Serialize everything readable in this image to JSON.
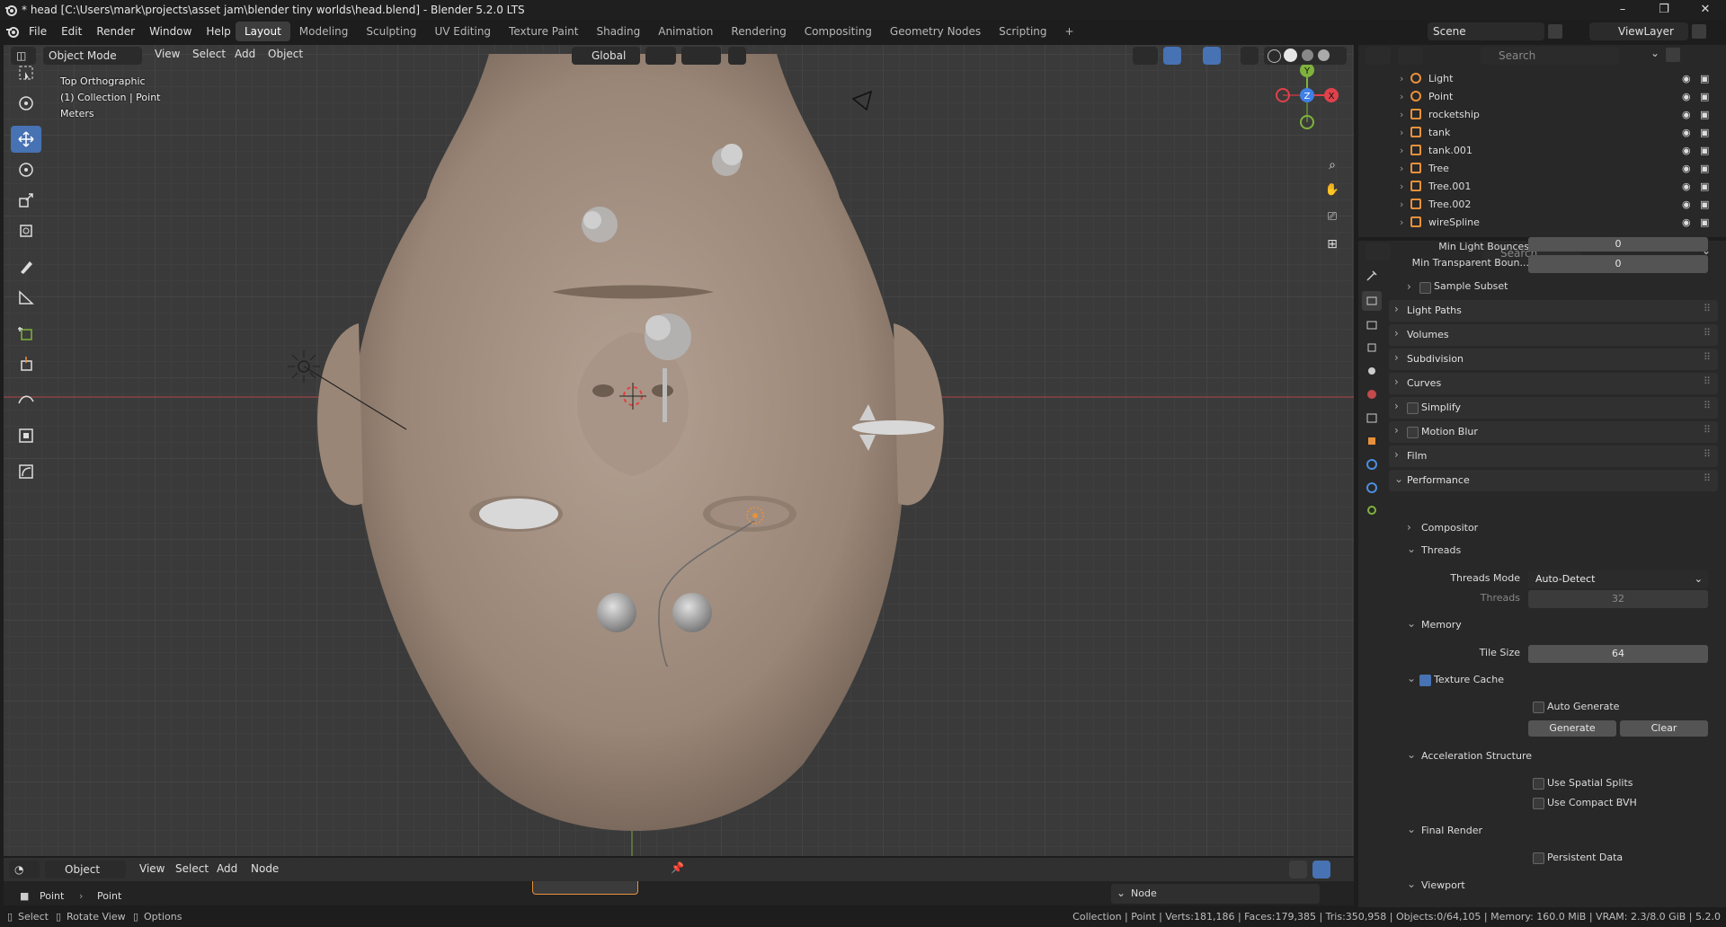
{
  "title_bar": {
    "title": "* head [C:\\Users\\mark\\projects\\asset jam\\blender tiny worlds\\head.blend] - Blender 5.2.0 LTS",
    "minimize": "–",
    "maximize": "❐",
    "close": "✕"
  },
  "menu": [
    "File",
    "Edit",
    "Render",
    "Window",
    "Help"
  ],
  "workspaces": [
    "Layout",
    "Modeling",
    "Sculpting",
    "UV Editing",
    "Texture Paint",
    "Shading",
    "Animation",
    "Rendering",
    "Compositing",
    "Geometry Nodes",
    "Scripting"
  ],
  "workspace_add": "+",
  "scene": "Scene",
  "view_layer": "ViewLayer",
  "viewport_header": {
    "mode": "Object Mode",
    "menus": [
      "View",
      "Select",
      "Add",
      "Object"
    ],
    "orientation": "Global"
  },
  "viewport_overlay": {
    "view_name": "Top Orthographic",
    "collection_line": "(1) Collection | Point",
    "units": "Meters"
  },
  "gizmo": {
    "y": "Y",
    "z": "Z",
    "x": "X"
  },
  "outliner": {
    "search_placeholder": "Search",
    "items": [
      {
        "name": "Light",
        "icon": "light-icon"
      },
      {
        "name": "Point",
        "icon": "light-icon"
      },
      {
        "name": "rocketship",
        "icon": "mesh-icon"
      },
      {
        "name": "tank",
        "icon": "mesh-icon"
      },
      {
        "name": "tank.001",
        "icon": "mesh-icon"
      },
      {
        "name": "Tree",
        "icon": "mesh-icon"
      },
      {
        "name": "Tree.001",
        "icon": "mesh-icon"
      },
      {
        "name": "Tree.002",
        "icon": "mesh-icon"
      },
      {
        "name": "wireSpline",
        "icon": "curve-icon"
      }
    ]
  },
  "properties": {
    "search_placeholder": "Search",
    "min_light_bounces": {
      "label": "Min Light Bounces",
      "value": "0"
    },
    "min_transparent_bounces": {
      "label": "Min Transparent Boun...",
      "value": "0"
    },
    "sample_subset": "Sample Subset",
    "sections": [
      "Light Paths",
      "Volumes",
      "Subdivision",
      "Curves",
      "Simplify",
      "Motion Blur",
      "Film",
      "Performance"
    ],
    "compositor": "Compositor",
    "threads": "Threads",
    "threads_mode": {
      "label": "Threads Mode",
      "value": "Auto-Detect"
    },
    "threads_count": {
      "label": "Threads",
      "value": "32"
    },
    "memory": "Memory",
    "tile_size": {
      "label": "Tile Size",
      "value": "64"
    },
    "texture_cache": "Texture Cache",
    "auto_generate": "Auto Generate",
    "generate_btn": "Generate",
    "clear_btn": "Clear",
    "acceleration": "Acceleration Structure",
    "spatial_splits": "Use Spatial Splits",
    "compact_bvh": "Use Compact BVH",
    "final_render": "Final Render",
    "persistent_data": "Persistent Data",
    "viewport": "Viewport"
  },
  "node_editor": {
    "object": "Object",
    "menus": [
      "View",
      "Select",
      "Add",
      "Node"
    ],
    "breadcrumb": [
      "Point",
      "Point"
    ],
    "node_panel": "Node"
  },
  "status_bar": {
    "select": "Select",
    "rotate": "Rotate View",
    "options": "Options",
    "stats": "Collection | Point | Verts:181,186 | Faces:179,385 | Tris:350,958 | Objects:0/64,105 | Memory: 160.0 MiB | VRAM: 2.3/8.0 GiB | 5.2.0"
  },
  "colors": {
    "accent": "#4772b3",
    "x_axis": "#e0414b",
    "y_axis": "#7fb23d",
    "z_axis": "#3f7fe6",
    "mesh_orange": "#e8913b"
  }
}
